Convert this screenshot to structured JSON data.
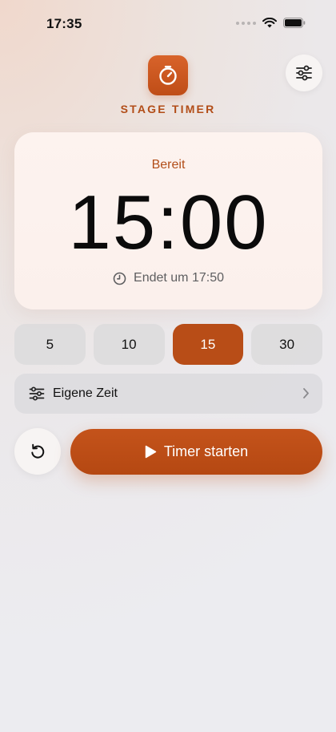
{
  "status_bar": {
    "time": "17:35",
    "icons": [
      "signal-dots",
      "wifi-icon",
      "battery-icon"
    ]
  },
  "header": {
    "app_icon": "stopwatch-icon",
    "app_title": "STAGE TIMER",
    "settings_icon": "sliders-icon"
  },
  "timer": {
    "status": "Bereit",
    "display": "15:00",
    "end_time_label": "Endet um 17:50",
    "end_time_icon": "clock-icon"
  },
  "presets": {
    "options": [
      "5",
      "10",
      "15",
      "30"
    ],
    "selected": "15"
  },
  "custom_time": {
    "label": "Eigene Zeit",
    "icon": "sliders-icon",
    "chevron": "chevron-right-icon"
  },
  "controls": {
    "reset_icon": "reset-icon",
    "start_label": "Timer starten",
    "start_icon": "play-icon"
  },
  "colors": {
    "accent": "#B84D17",
    "accent_text": "#B24D18",
    "card_background": "#FDF3EF",
    "preset_background": "#DCDADC"
  }
}
